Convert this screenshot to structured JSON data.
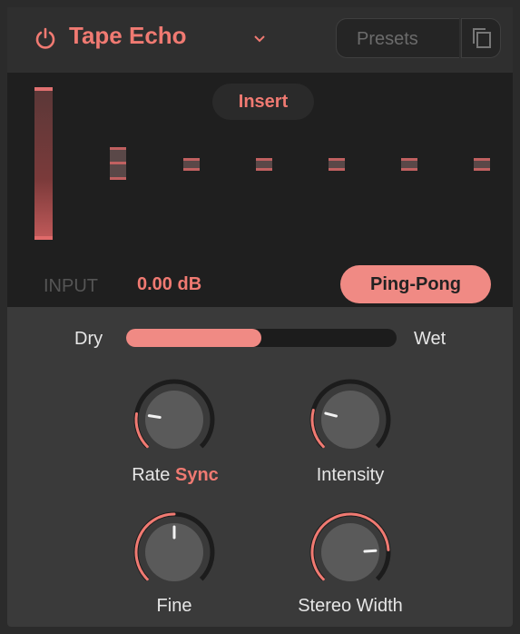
{
  "header": {
    "title": "Tape Echo",
    "presets_placeholder": "Presets",
    "icons": {
      "power": "power-icon",
      "dropdown": "chevron-down-icon",
      "copy": "copy-icon"
    }
  },
  "display": {
    "mode_label": "Insert",
    "input_label": "INPUT",
    "input_value": "0.00 dB",
    "ping_pong_label": "Ping-Pong"
  },
  "mix": {
    "dry_label": "Dry",
    "wet_label": "Wet",
    "value": 0.5
  },
  "knobs": {
    "rate": {
      "label": "Rate",
      "sync_label": "Sync",
      "value": 0.2
    },
    "intensity": {
      "label": "Intensity",
      "value": 0.22
    },
    "fine": {
      "label": "Fine",
      "value": 0.5
    },
    "stereo_width": {
      "label": "Stereo Width",
      "value": 0.82
    }
  },
  "colors": {
    "accent": "#f07a72",
    "track": "#1c1c1c",
    "knob": "#5a5a5a"
  }
}
